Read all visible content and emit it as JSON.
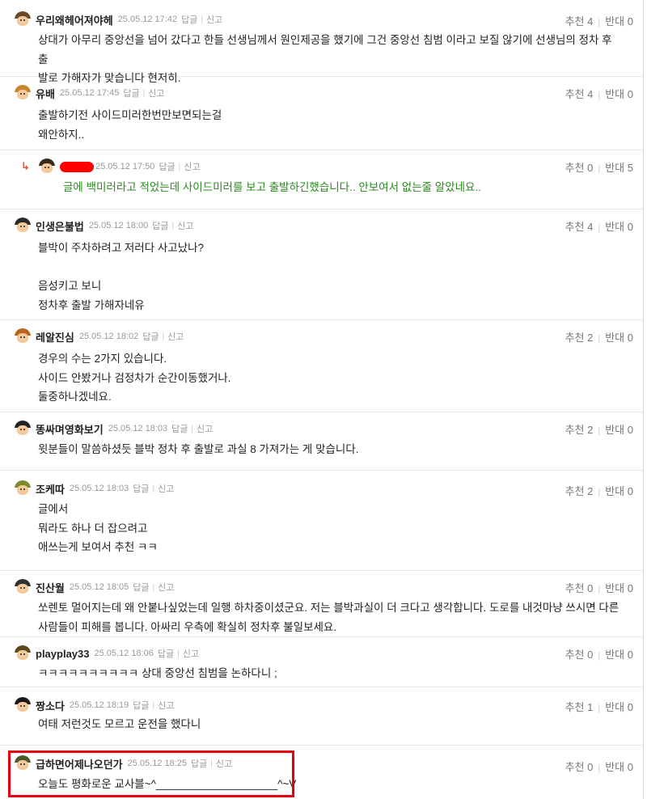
{
  "labels": {
    "reply": "답글",
    "report": "신고",
    "recommend": "추천",
    "oppose": "반대"
  },
  "colors": {
    "highlight_border": "#e60012",
    "reply_text": "#2a8a1e",
    "reply_arrow": "#e0512e"
  },
  "comments": [
    {
      "nick": "우리왜헤어져야헤",
      "date": "25.05.12 17:42",
      "up": "4",
      "down": "0",
      "avatar_cap": "#6b4a2a",
      "text": "상대가 아무리 중앙선을 넘어 갔다고 한들 선생님께서 원인제공을 했기에 그건 중앙선 침범 이라고 보질 않기에 선생님의 정차 후 출\n발로 가해자가 맞습니다 현저히."
    },
    {
      "nick": "유배",
      "date": "25.05.12 17:45",
      "up": "4",
      "down": "0",
      "avatar_cap": "#c8862a",
      "text": "출발하기전 사이드미러한번만보면되는걸\n왜안하지.."
    },
    {
      "nick": "",
      "date": "25.05.12 17:50",
      "up": "0",
      "down": "5",
      "avatar_cap": "#3a2a1a",
      "reply": true,
      "arrow": "↳",
      "text": "글에 백미러라고 적었는데 사이드미러를 보고 출발하긴했습니다.. 안보여서 없는줄 알았네요.."
    },
    {
      "nick": "인생은불법",
      "date": "25.05.12 18:00",
      "up": "4",
      "down": "0",
      "avatar_cap": "#2a2a2a",
      "text": "블박이 주차하려고 저러다 사고났나?\n\n음성키고 보니\n정차후 출발 가해자네유"
    },
    {
      "nick": "레알진심",
      "date": "25.05.12 18:02",
      "up": "2",
      "down": "0",
      "avatar_cap": "#b8651f",
      "text": "경우의 수는 2가지 있습니다.\n사이드 안봤거나 검정차가 순간이동했거나.\n둘중하나겠네요."
    },
    {
      "nick": "똥싸며영화보기",
      "date": "25.05.12 18:03",
      "up": "2",
      "down": "0",
      "avatar_cap": "#222222",
      "text": "윗분들이 말씀하셨듯 블박 정차 후 출발로 과실 8 가져가는 게 맞습니다."
    },
    {
      "nick": "조케따",
      "date": "25.05.12 18:03",
      "up": "2",
      "down": "0",
      "avatar_cap": "#7a8a2a",
      "text": "글에서\n뭐라도 하나 더 잡으려고\n애쓰는게 보여서 추천 ㅋㅋ"
    },
    {
      "nick": "진산월",
      "date": "25.05.12 18:05",
      "up": "0",
      "down": "0",
      "avatar_cap": "#333333",
      "text": "쏘렌토 멀어지는데 왜 안붙나싶었는데 일행 하차중이셨군요. 저는 블박과실이 더 크다고 생각합니다. 도로를 내것마냥 쓰시면 다른\n사람들이 피해를 봅니다. 아싸리 우측에 확실히 정차후 불일보세요."
    },
    {
      "nick": "playplay33",
      "date": "25.05.12 18:06",
      "up": "0",
      "down": "0",
      "avatar_cap": "#5a4a1a",
      "text": "ㅋㅋㅋㅋㅋㅋㅋㅋㅋㅋ 상대 중앙선 침범을 논하다니 ;"
    },
    {
      "nick": "짱소다",
      "date": "25.05.12 18:19",
      "up": "1",
      "down": "0",
      "avatar_cap": "#1a1a1a",
      "text": "여태 저런것도 모르고 운전을 했다니"
    },
    {
      "nick": "급하면어제나오던가",
      "date": "25.05.12 18:25",
      "up": "0",
      "down": "0",
      "avatar_cap": "#4a5a2a",
      "text": "오늘도 평화로운 교사블~^____________________^~V"
    }
  ]
}
